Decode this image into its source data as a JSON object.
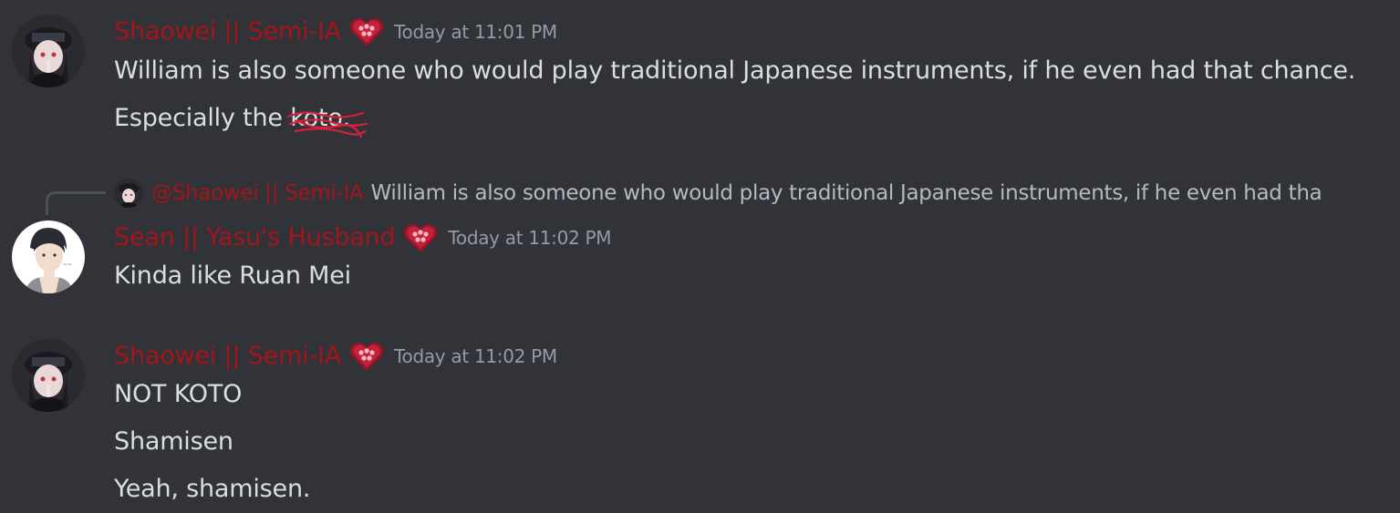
{
  "messages": [
    {
      "username": "Shaowei || Semi-IA",
      "timestamp": "Today at 11:01 PM",
      "lines": [
        "William is also someone who would play traditional Japanese instruments, if he even had that chance.",
        "Especially the ",
        "koto",
        "."
      ]
    },
    {
      "reply": {
        "mention": "@Shaowei || Semi-IA",
        "text": "William is also someone who would play traditional Japanese instruments, if he even had tha"
      },
      "username": "Sean || Yasu's Husband",
      "timestamp": "Today at 11:02 PM",
      "lines": [
        "Kinda like Ruan Mei"
      ]
    },
    {
      "username": "Shaowei || Semi-IA",
      "timestamp": "Today at 11:02 PM",
      "lines": [
        "NOT KOTO",
        "Shamisen",
        "Yeah, shamisen."
      ]
    }
  ],
  "colors": {
    "background": "#313338",
    "username": "#a3151b",
    "text": "#dbdee1",
    "timestamp": "#949ba4",
    "reply_text": "#b5bac1",
    "scribble": "#d8203a"
  },
  "icons": {
    "role": "red-heart-role-icon",
    "avatar_shaowei": "dark-haired-figure-avatar",
    "avatar_sean": "man-portrait-avatar"
  }
}
